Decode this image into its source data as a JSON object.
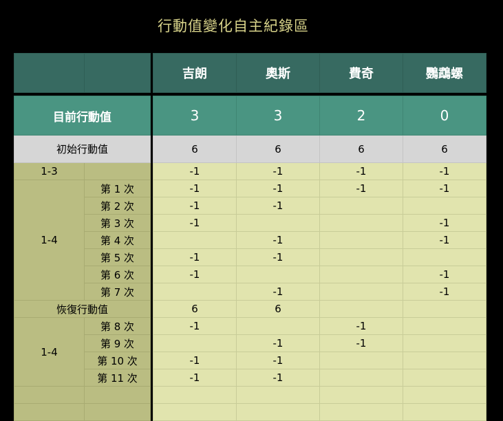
{
  "title": "行動值變化自主紀錄區",
  "players": [
    "吉朗",
    "奧斯",
    "費奇",
    "鸚鵡螺"
  ],
  "current": {
    "label": "目前行動值",
    "values": [
      "3",
      "3",
      "2",
      "0"
    ]
  },
  "initial": {
    "label": "初始行動值",
    "values": [
      "6",
      "6",
      "6",
      "6"
    ]
  },
  "rows": [
    {
      "group": "1-3",
      "sub": "",
      "values": [
        "-1",
        "-1",
        "-1",
        "-1"
      ]
    },
    {
      "group": "",
      "sub": "第 1 次",
      "values": [
        "-1",
        "-1",
        "-1",
        "-1"
      ]
    },
    {
      "group": "",
      "sub": "第 2 次",
      "values": [
        "-1",
        "-1",
        "",
        ""
      ]
    },
    {
      "group": "",
      "sub": "第 3 次",
      "values": [
        "-1",
        "",
        "",
        "-1"
      ]
    },
    {
      "group": "1-4",
      "sub": "第 4 次",
      "values": [
        "",
        "-1",
        "",
        "-1"
      ]
    },
    {
      "group": "",
      "sub": "第 5 次",
      "values": [
        "-1",
        "-1",
        "",
        ""
      ]
    },
    {
      "group": "",
      "sub": "第 6 次",
      "values": [
        "-1",
        "",
        "",
        "-1"
      ]
    },
    {
      "group": "",
      "sub": "第 7 次",
      "values": [
        "",
        "-1",
        "",
        "-1"
      ]
    },
    {
      "group": "恢復行動值",
      "sub": "",
      "values": [
        "6",
        "6",
        "",
        ""
      ]
    },
    {
      "group": "",
      "sub": "第 8 次",
      "values": [
        "-1",
        "",
        "-1",
        ""
      ]
    },
    {
      "group": "1-4",
      "sub": "第 9 次",
      "values": [
        "",
        "-1",
        "-1",
        ""
      ]
    },
    {
      "group": "",
      "sub": "第 10 次",
      "values": [
        "-1",
        "-1",
        "",
        ""
      ]
    },
    {
      "group": "",
      "sub": "第 11 次",
      "values": [
        "-1",
        "-1",
        "",
        ""
      ]
    },
    {
      "group": "",
      "sub": "",
      "values": [
        "",
        "",
        "",
        ""
      ]
    },
    {
      "group": "",
      "sub": "",
      "values": [
        "",
        "",
        "",
        ""
      ]
    }
  ]
}
